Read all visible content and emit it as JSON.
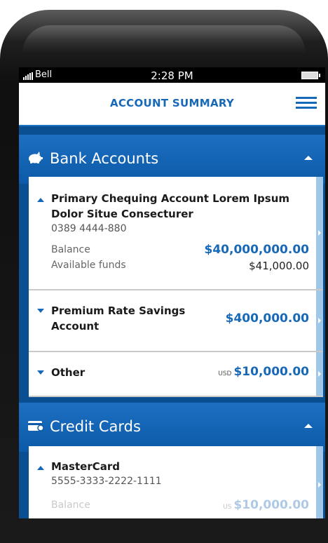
{
  "status_bar": {
    "carrier": "Bell",
    "time": "2:28 PM"
  },
  "header": {
    "title": "ACCOUNT SUMMARY"
  },
  "bank_section": {
    "title": "Bank Accounts",
    "accounts": [
      {
        "name": "Primary Chequing Account Lorem Ipsum Dolor Situe Consecturer",
        "number": "0389 4444-880",
        "balance_label": "Balance",
        "balance": "$40,000,000.00",
        "available_label": "Available funds",
        "available": "$41,000.00"
      },
      {
        "name": "Premium Rate Savings Account",
        "amount": "$400,000.00"
      },
      {
        "name": "Other",
        "currency": "USD",
        "amount": "$10,000.00"
      }
    ]
  },
  "credit_section": {
    "title": "Credit Cards",
    "cards": [
      {
        "name": "MasterCard",
        "number": "5555-3333-2222-1111",
        "balance_label": "Balance",
        "currency": "US",
        "balance": "$10,000.00"
      }
    ]
  },
  "colors": {
    "accent": "#1868b8",
    "section_bg": "#0c5aa8",
    "stripe": "#9fc7e8"
  }
}
